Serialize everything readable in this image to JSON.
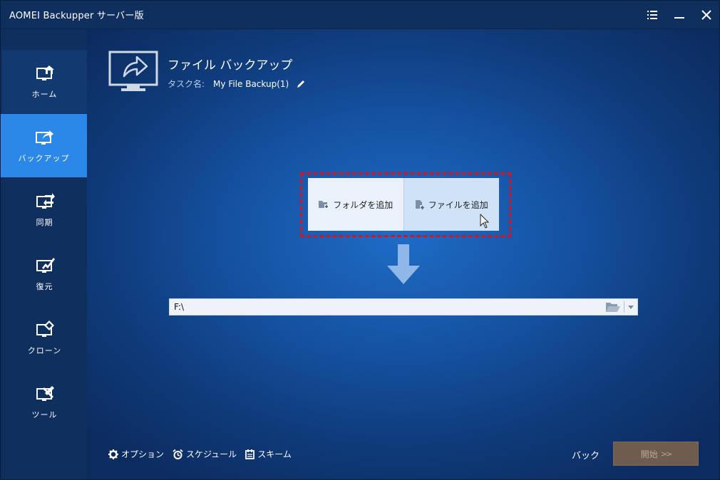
{
  "window": {
    "title": "AOMEI Backupper サーバー版"
  },
  "titlebar": {
    "menu_icon": "menu-list-icon",
    "minimize_icon": "minimize-icon",
    "close_icon": "close-icon"
  },
  "sidebar": {
    "items": [
      {
        "label": "ホーム",
        "icon": "home-icon"
      },
      {
        "label": "バックアップ",
        "icon": "backup-icon",
        "active": true
      },
      {
        "label": "同期",
        "icon": "sync-icon"
      },
      {
        "label": "復元",
        "icon": "restore-icon"
      },
      {
        "label": "クローン",
        "icon": "clone-icon"
      },
      {
        "label": "ツール",
        "icon": "tools-icon"
      }
    ]
  },
  "header": {
    "title": "ファイル バックアップ",
    "task_label": "タスク名:",
    "task_name": "My File Backup(1)"
  },
  "source": {
    "add_folder_label": "フォルダを追加",
    "add_file_label": "ファイルを追加",
    "highlight_color": "#e0101a"
  },
  "destination": {
    "path": "F:\\"
  },
  "footer": {
    "options_label": "オプション",
    "schedule_label": "スケジュール",
    "scheme_label": "スキーム",
    "back_label": "バック",
    "start_label": "開始",
    "start_chevrons": ">>"
  },
  "colors": {
    "accent": "#2b87e8",
    "sidebar_bg": "#0f2f5f",
    "start_button_bg": "#6f5c4f"
  }
}
